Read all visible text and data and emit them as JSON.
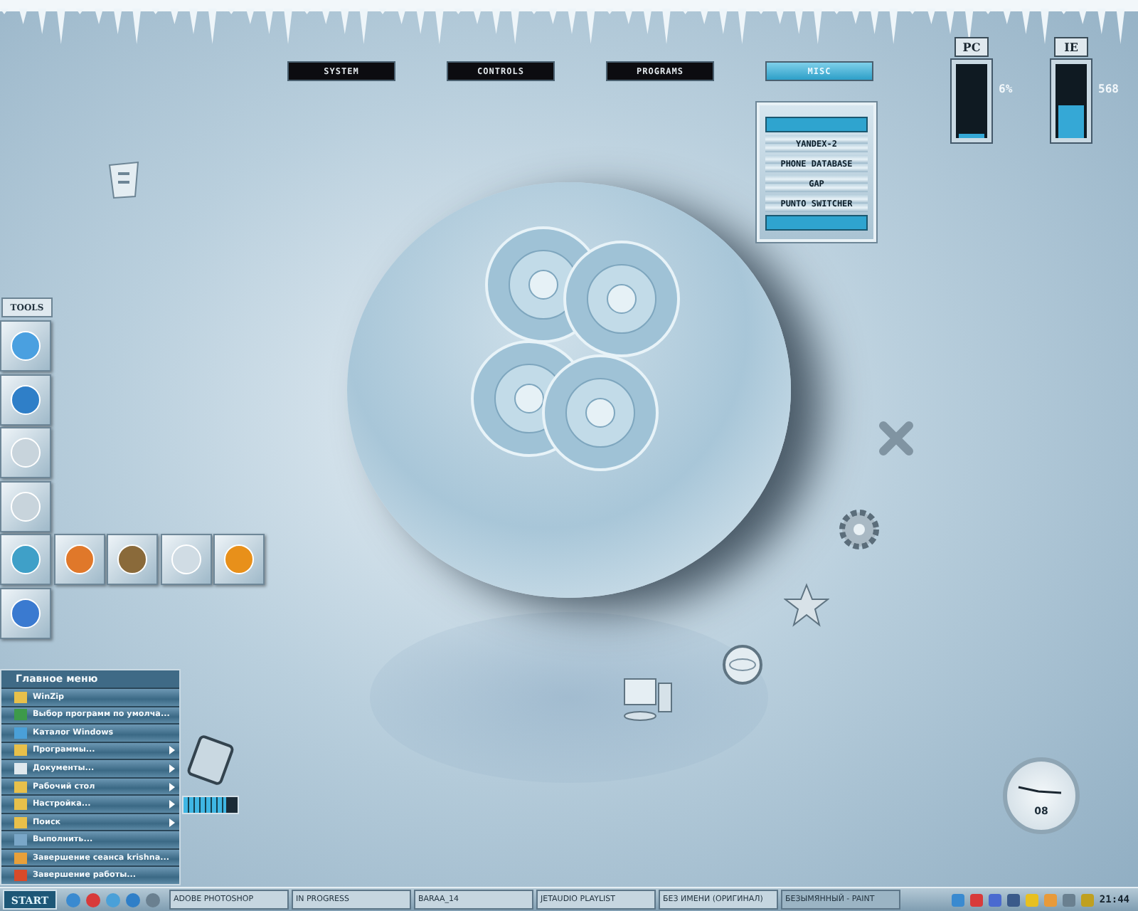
{
  "top_menu": [
    {
      "label": "SYSTEM",
      "selected": false
    },
    {
      "label": "CONTROLS",
      "selected": false
    },
    {
      "label": "PROGRAMS",
      "selected": false
    },
    {
      "label": "MISC",
      "selected": true
    }
  ],
  "misc_menu": {
    "items": [
      "YANDEX-2",
      "PHONE DATABASE",
      "GAP",
      "PUNTO SWITCHER"
    ]
  },
  "meters": [
    {
      "label": "PC",
      "reading": "6%",
      "level": 0.06
    },
    {
      "label": "IE",
      "reading": "568",
      "level": 0.45
    }
  ],
  "tools": {
    "label": "TOOLS"
  },
  "start_menu": {
    "title": "Главное меню",
    "items": [
      {
        "label": "WinZip",
        "submenu": false
      },
      {
        "label": "Выбор программ по умолча...",
        "submenu": false
      },
      {
        "label": "Каталог Windows",
        "submenu": false
      },
      {
        "label": "Программы...",
        "submenu": true
      },
      {
        "label": "Документы...",
        "submenu": true
      },
      {
        "label": "Рабочий стол",
        "submenu": true
      },
      {
        "label": "Настройка...",
        "submenu": true
      },
      {
        "label": "Поиск",
        "submenu": true
      },
      {
        "label": "Выполнить...",
        "submenu": false
      },
      {
        "label": "Завершение сеанса krishna...",
        "submenu": false
      },
      {
        "label": "Завершение работы...",
        "submenu": false
      }
    ]
  },
  "device_meter": {
    "level": 0.8
  },
  "clock_widget": {
    "date": "08"
  },
  "taskbar": {
    "start": "START",
    "tasks": [
      {
        "label": "ADOBE PHOTOSHOP",
        "selected": false
      },
      {
        "label": "IN PROGRESS",
        "selected": false
      },
      {
        "label": "BARAA_14",
        "selected": false
      },
      {
        "label": "JETAUDIO PLAYLIST",
        "selected": false
      },
      {
        "label": "БЕЗ ИМЕНИ (ОРИГИНАЛ)",
        "selected": false
      },
      {
        "label": "БЕЗЫМЯННЫЙ - PAINT",
        "selected": true
      }
    ],
    "time": "21:44"
  }
}
